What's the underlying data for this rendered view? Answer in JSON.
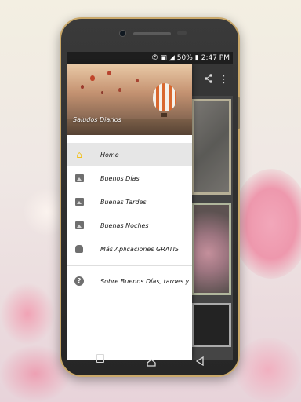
{
  "status_bar": {
    "battery": "50%",
    "time": "2:47 PM"
  },
  "drawer": {
    "header_title": "Saludos Diarios",
    "items": [
      {
        "label": "Home",
        "icon": "home-icon",
        "selected": true
      },
      {
        "label": "Buenos Días",
        "icon": "image-icon",
        "selected": false
      },
      {
        "label": "Buenas Tardes",
        "icon": "image-icon",
        "selected": false
      },
      {
        "label": "Buenas Noches",
        "icon": "image-icon",
        "selected": false
      },
      {
        "label": "Más Aplicaciones GRATIS",
        "icon": "android-icon",
        "selected": false
      }
    ],
    "footer_item": {
      "label": "Sobre Buenos Días, tardes y",
      "icon": "help-icon"
    }
  },
  "colors": {
    "home_icon": "#f3c01a",
    "selected_item_bg": "#e6e6e6",
    "phone_frame_trim": "#c9a86a"
  }
}
